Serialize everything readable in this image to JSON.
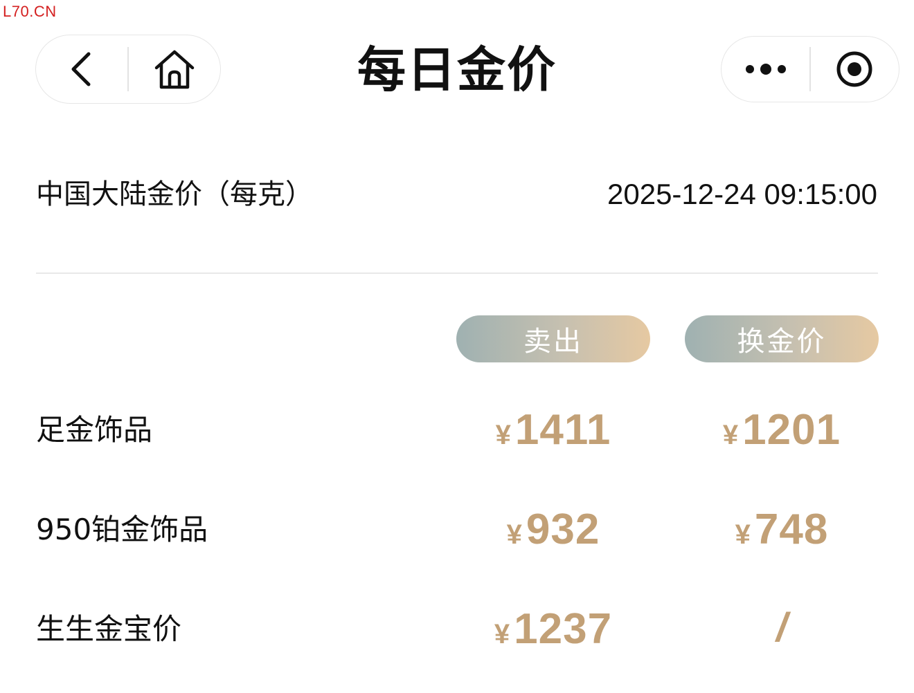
{
  "watermark": "L70.CN",
  "nav": {
    "title": "每日金价",
    "back_icon": "chevron-left-icon",
    "home_icon": "home-icon",
    "more_icon": "more-dots-icon",
    "close_icon": "target-circle-icon"
  },
  "header": {
    "region_label": "中国大陆金价（每克）",
    "timestamp": "2025-12-24 09:15:00"
  },
  "columns": {
    "sell": "卖出",
    "exchange": "换金价"
  },
  "currency": "¥",
  "rows": [
    {
      "label": "足金饰品",
      "sell": "1411",
      "exchange": "1201"
    },
    {
      "label": "950铂金饰品",
      "sell": "932",
      "exchange": "748"
    },
    {
      "label": "生生金宝价",
      "sell": "1237",
      "exchange": "/"
    }
  ],
  "colors": {
    "price": "#c2a076",
    "pill_gradient_start": "#9fb1b1",
    "pill_gradient_end": "#e6c9a2"
  }
}
